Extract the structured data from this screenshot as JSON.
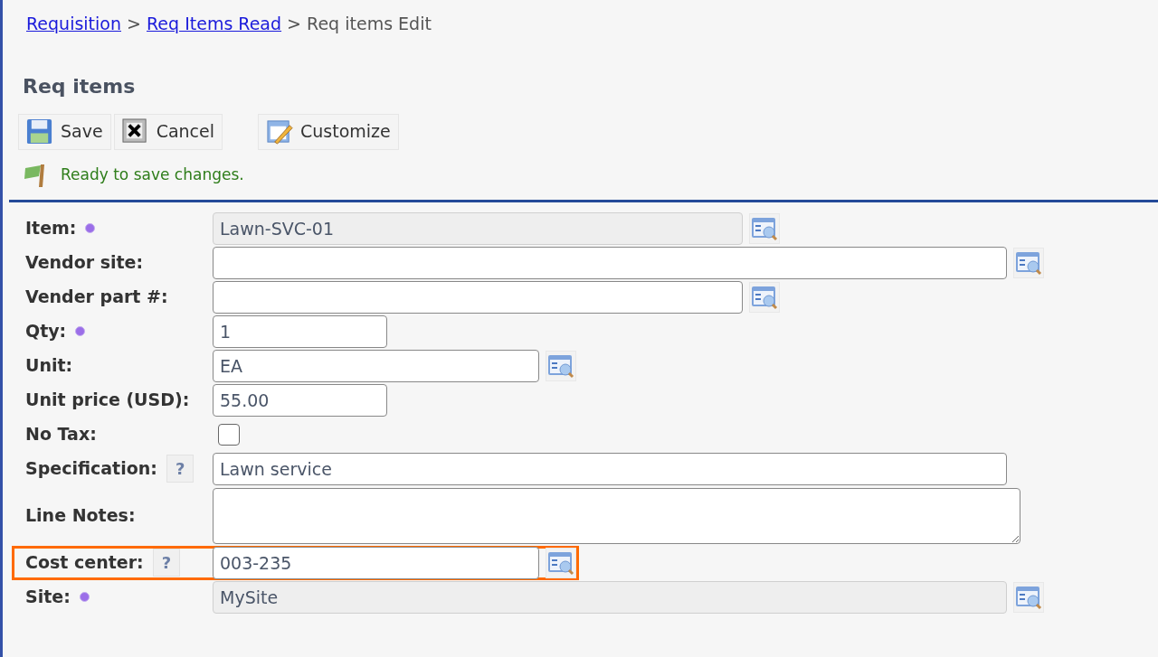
{
  "breadcrumb": [
    {
      "label": "Requisition",
      "link": true
    },
    {
      "label": "Req Items Read",
      "link": true
    },
    {
      "label": "Req items Edit",
      "link": false
    }
  ],
  "breadcrumb_separator": ">",
  "heading": "Req items",
  "toolbar": [
    {
      "label": "Save",
      "kind": "save"
    },
    {
      "label": "Cancel",
      "kind": "cancel"
    },
    {
      "label": "Customize",
      "kind": "customize"
    }
  ],
  "status_message": "Ready to save changes.",
  "fields": [
    {
      "label": "Item:",
      "required": true,
      "help": false,
      "kind": "readonly",
      "value": "Lawn-SVC-01",
      "lookup": true,
      "highlighted": false
    },
    {
      "label": "Vendor site:",
      "required": false,
      "help": false,
      "kind": "text",
      "lookup": true,
      "highlighted": false
    },
    {
      "label": "Vender part #:",
      "required": false,
      "help": false,
      "kind": "text",
      "lookup": true,
      "highlighted": false
    },
    {
      "label": "Qty:",
      "required": true,
      "help": false,
      "kind": "text",
      "value": "1",
      "lookup": false,
      "highlighted": false
    },
    {
      "label": "Unit:",
      "required": false,
      "help": false,
      "kind": "text",
      "value": "EA",
      "lookup": true,
      "highlighted": false
    },
    {
      "label": "Unit price (USD):",
      "required": false,
      "help": false,
      "kind": "text",
      "value": "55.00",
      "lookup": false,
      "highlighted": false
    },
    {
      "label": "No Tax:",
      "required": false,
      "help": false,
      "kind": "checkbox",
      "checked": false,
      "lookup": false,
      "highlighted": false
    },
    {
      "label": "Specification:",
      "required": false,
      "help": true,
      "help_text": "?",
      "kind": "text",
      "value": "Lawn service",
      "lookup": false,
      "highlighted": false
    },
    {
      "label": "Line Notes:",
      "required": false,
      "help": false,
      "kind": "textarea",
      "lookup": false,
      "highlighted": false
    },
    {
      "label": "Cost center:",
      "required": false,
      "help": true,
      "help_text": "?",
      "kind": "text",
      "value": "003-235",
      "lookup": true,
      "highlighted": true
    },
    {
      "label": "Site:",
      "required": true,
      "help": false,
      "kind": "readonly",
      "value": "MySite",
      "lookup": true,
      "highlighted": false
    }
  ]
}
